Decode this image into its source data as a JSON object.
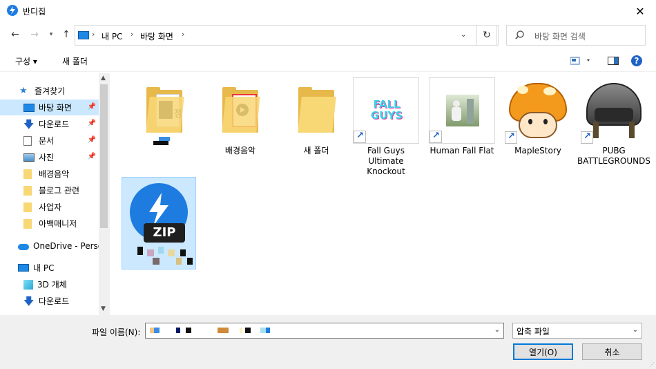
{
  "window": {
    "title": "반디집",
    "close_label": "✕"
  },
  "address": {
    "segments": [
      "내 PC",
      "바탕 화면"
    ]
  },
  "search": {
    "placeholder": "바탕 화면 검색"
  },
  "toolbar": {
    "organize": "구성 ▾",
    "new_folder": "새 폴더",
    "help_label": "?"
  },
  "sidebar": {
    "items": [
      {
        "label": "즐겨찾기",
        "icon": "star-icon",
        "pinned": false
      },
      {
        "label": "바탕 화면",
        "icon": "desktop-icon",
        "pinned": true,
        "selected": true
      },
      {
        "label": "다운로드",
        "icon": "download-icon",
        "pinned": true
      },
      {
        "label": "문서",
        "icon": "document-icon",
        "pinned": true
      },
      {
        "label": "사진",
        "icon": "picture-icon",
        "pinned": true
      },
      {
        "label": "배경음악",
        "icon": "folder-icon",
        "pinned": false
      },
      {
        "label": "블로그 관련",
        "icon": "folder-icon",
        "pinned": false
      },
      {
        "label": "사업자",
        "icon": "folder-icon",
        "pinned": false
      },
      {
        "label": "아백매니저",
        "icon": "folder-icon",
        "pinned": false
      },
      {
        "label": "OneDrive - Persor",
        "icon": "cloud-icon",
        "pinned": false
      },
      {
        "label": "내 PC",
        "icon": "pc-icon",
        "pinned": false
      },
      {
        "label": "3D 개체",
        "icon": "cube-icon",
        "pinned": false
      },
      {
        "label": "다운로드",
        "icon": "download-icon",
        "pinned": false
      }
    ]
  },
  "files": [
    {
      "label": "",
      "type": "folder-doc"
    },
    {
      "label": "배경음악",
      "type": "folder-media"
    },
    {
      "label": "새 폴더",
      "type": "folder"
    },
    {
      "label": "Fall Guys Ultimate Knockout",
      "type": "shortcut",
      "art_text": "FALL GUYS"
    },
    {
      "label": "Human Fall Flat",
      "type": "shortcut"
    },
    {
      "label": "MapleStory",
      "type": "shortcut"
    },
    {
      "label": "PUBG BATTLEGROUNDS",
      "type": "shortcut"
    },
    {
      "label": "",
      "type": "zip",
      "selected": true,
      "badge": "ZIP"
    }
  ],
  "bottom": {
    "filename_label": "파일 이름(N):",
    "filetype": "압축 파일",
    "open_button": "열기(O)",
    "cancel_button": "취소"
  },
  "colors": {
    "accent": "#0078d7",
    "selection": "#cce8ff",
    "folder": "#f8d775"
  }
}
